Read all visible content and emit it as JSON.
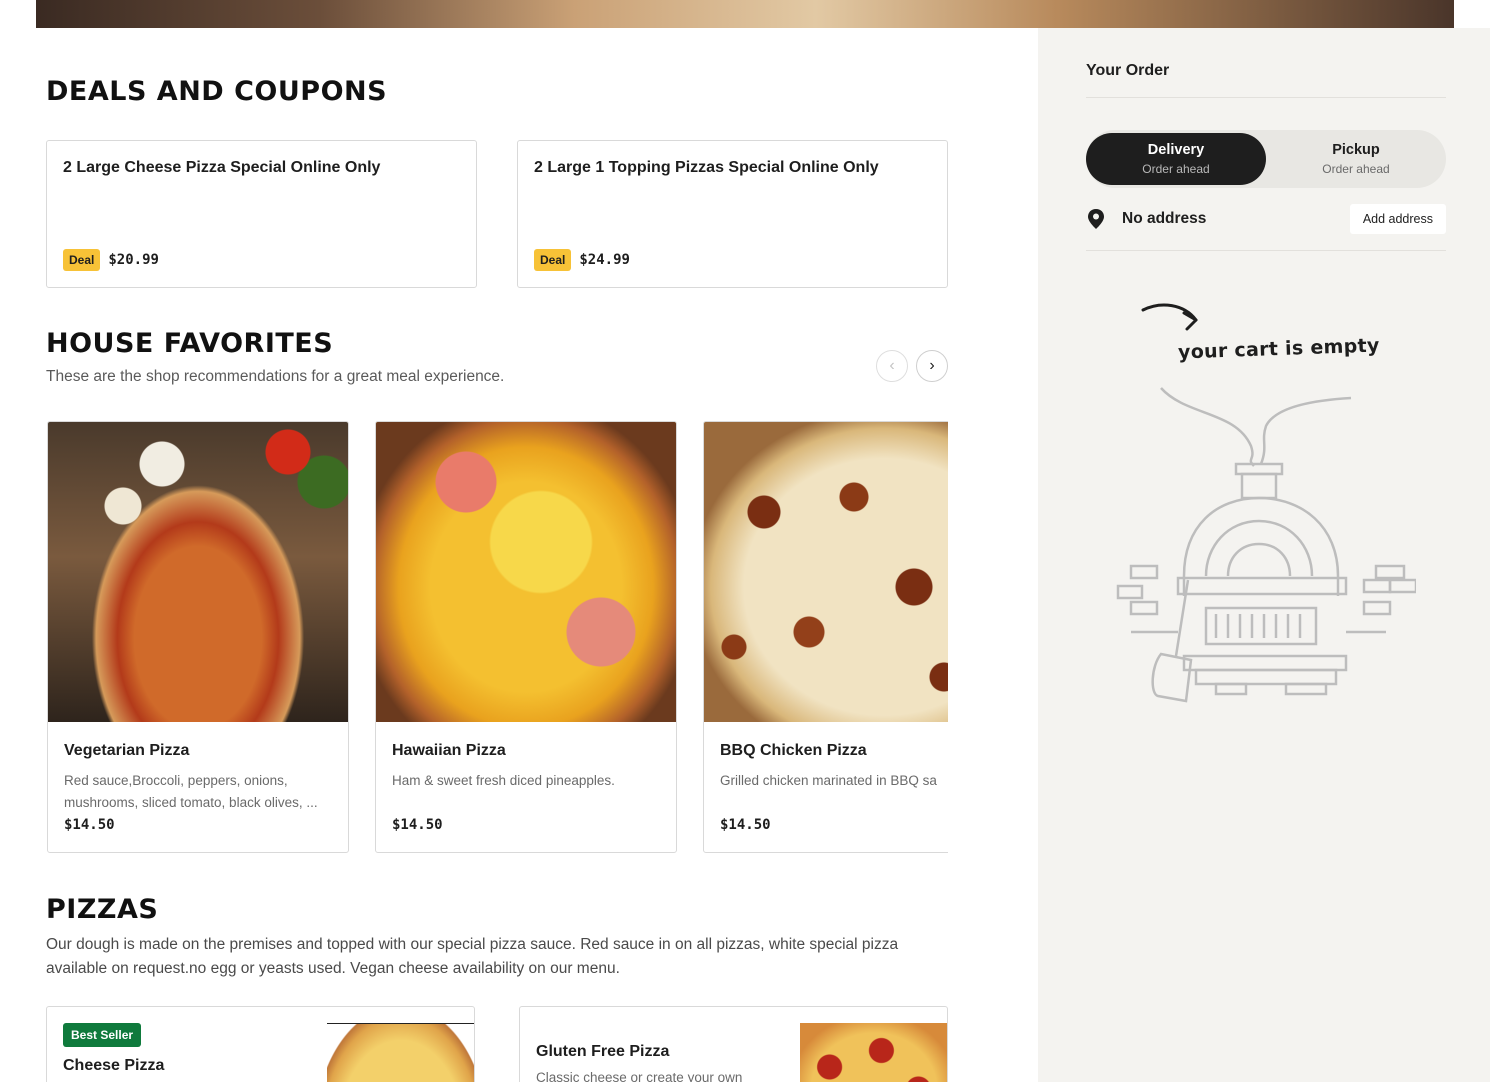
{
  "deals": {
    "title": "DEALS AND COUPONS",
    "items": [
      {
        "name": "2 Large Cheese Pizza Special Online Only",
        "badge": "Deal",
        "price": "$20.99"
      },
      {
        "name": "2 Large 1 Topping Pizzas Special Online Only",
        "badge": "Deal",
        "price": "$24.99"
      }
    ]
  },
  "favorites": {
    "title": "HOUSE FAVORITES",
    "subtitle": "These are the shop recommendations for a great meal experience.",
    "prev_icon": "chevron-left-icon",
    "next_icon": "chevron-right-icon",
    "items": [
      {
        "name": "Vegetarian Pizza",
        "description": "Red sauce,Broccoli, peppers, onions, mushrooms, sliced tomato, black olives, ...",
        "price": "$14.50"
      },
      {
        "name": "Hawaiian Pizza",
        "description": "Ham & sweet fresh diced pineapples.",
        "price": "$14.50"
      },
      {
        "name": "BBQ Chicken Pizza",
        "description": "Grilled chicken marinated in BBQ sa",
        "price": "$14.50"
      }
    ]
  },
  "pizzas": {
    "title": "PIZZAS",
    "description": "Our dough is made on the premises and topped with our special pizza sauce. Red sauce in on all pizzas, white special pizza available on request.no egg or yeasts used. Vegan cheese availability on our menu.",
    "items": [
      {
        "badge": "Best Seller",
        "name": "Cheese Pizza"
      },
      {
        "name": "Gluten Free Pizza",
        "description": "Classic cheese or create your own"
      }
    ]
  },
  "order": {
    "title": "Your Order",
    "delivery_label": "Delivery",
    "delivery_sub": "Order ahead",
    "pickup_label": "Pickup",
    "pickup_sub": "Order ahead",
    "address": "No address",
    "add_address_label": "Add address",
    "empty_message": "your cart is empty"
  },
  "colors": {
    "accent_dark": "#1e1e1e",
    "deal_badge": "#f7c237",
    "best_seller_badge": "#0f7a3c",
    "sidebar_bg": "#f4f3f0"
  }
}
